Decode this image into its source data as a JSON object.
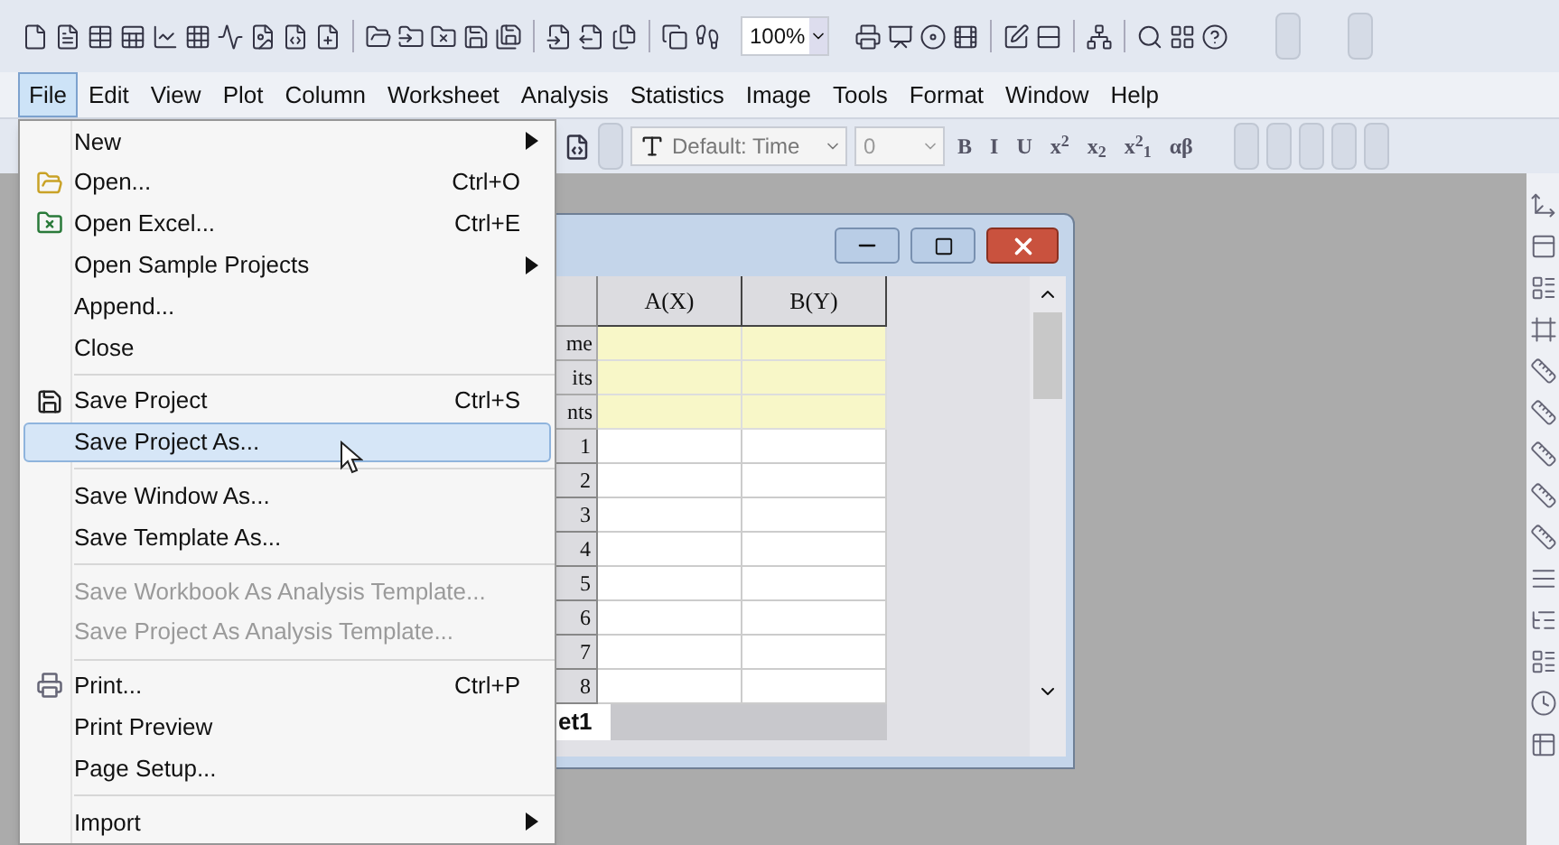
{
  "toolbar": {
    "zoom": "100%"
  },
  "menu_bar": [
    {
      "label": "File",
      "selected": true
    },
    {
      "label": "Edit",
      "selected": false
    },
    {
      "label": "View",
      "selected": false
    },
    {
      "label": "Plot",
      "selected": false
    },
    {
      "label": "Column",
      "selected": false
    },
    {
      "label": "Worksheet",
      "selected": false
    },
    {
      "label": "Analysis",
      "selected": false
    },
    {
      "label": "Statistics",
      "selected": false
    },
    {
      "label": "Image",
      "selected": false
    },
    {
      "label": "Tools",
      "selected": false
    },
    {
      "label": "Format",
      "selected": false
    },
    {
      "label": "Window",
      "selected": false
    },
    {
      "label": "Help",
      "selected": false
    }
  ],
  "format_toolbar": {
    "font": "Default: Time",
    "size": "0",
    "buttons": [
      "B",
      "I",
      "U",
      "x$^{2}$",
      "x$_{2}$",
      "x$^{2}$$_{1}$",
      "αβ"
    ]
  },
  "file_menu": [
    {
      "kind": "item",
      "label": "New",
      "submenu": true,
      "disabled": false,
      "selected": false
    },
    {
      "kind": "item",
      "label": "Open...",
      "shortcut": "Ctrl+O",
      "disabled": false,
      "selected": false
    },
    {
      "kind": "item",
      "label": "Open Excel...",
      "shortcut": "Ctrl+E",
      "disabled": false,
      "selected": false
    },
    {
      "kind": "item",
      "label": "Open Sample Projects",
      "submenu": true,
      "disabled": false,
      "selected": false
    },
    {
      "kind": "item",
      "label": "Append...",
      "disabled": false,
      "selected": false
    },
    {
      "kind": "item",
      "label": "Close",
      "disabled": false,
      "selected": false
    },
    {
      "kind": "separator"
    },
    {
      "kind": "item",
      "label": "Save Project",
      "shortcut": "Ctrl+S",
      "disabled": false,
      "selected": false
    },
    {
      "kind": "item",
      "label": "Save Project As...",
      "disabled": false,
      "selected": true
    },
    {
      "kind": "separator"
    },
    {
      "kind": "item",
      "label": "Save Window As...",
      "disabled": false,
      "selected": false
    },
    {
      "kind": "item",
      "label": "Save Template As...",
      "disabled": false,
      "selected": false
    },
    {
      "kind": "separator"
    },
    {
      "kind": "item",
      "label": "Save Workbook As Analysis Template...",
      "disabled": true,
      "selected": false
    },
    {
      "kind": "item",
      "label": "Save Project As Analysis Template...",
      "disabled": true,
      "selected": false
    },
    {
      "kind": "separator"
    },
    {
      "kind": "item",
      "label": "Print...",
      "shortcut": "Ctrl+P",
      "disabled": false,
      "selected": false
    },
    {
      "kind": "item",
      "label": "Print Preview",
      "disabled": false,
      "selected": false
    },
    {
      "kind": "item",
      "label": "Page Setup...",
      "disabled": false,
      "selected": false
    },
    {
      "kind": "separator"
    },
    {
      "kind": "item",
      "label": "Import",
      "submenu": true,
      "disabled": false,
      "selected": false
    }
  ],
  "workbook": {
    "columns": [
      "A(X)",
      "B(Y)"
    ],
    "header_rows": [
      "me",
      "its",
      "nts"
    ],
    "rows": [
      "1",
      "2",
      "3",
      "4",
      "5",
      "6",
      "7",
      "8"
    ],
    "sheet_tab": "et1"
  }
}
